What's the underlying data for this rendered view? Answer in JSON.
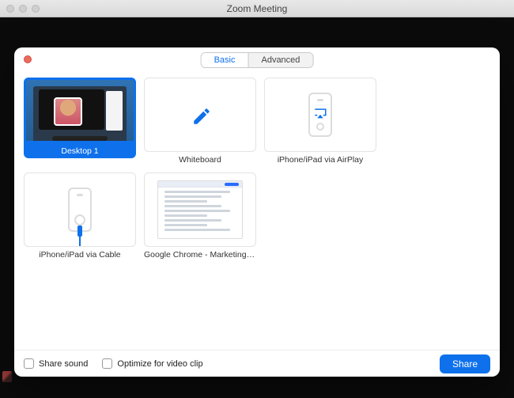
{
  "window": {
    "title": "Zoom Meeting"
  },
  "tabs": {
    "basic": "Basic",
    "advanced": "Advanced",
    "active": "basic"
  },
  "options": [
    {
      "id": "desktop1",
      "label": "Desktop 1",
      "selected": true,
      "kind": "screen"
    },
    {
      "id": "whiteboard",
      "label": "Whiteboard",
      "selected": false,
      "kind": "whiteboard"
    },
    {
      "id": "airplay",
      "label": "iPhone/iPad via AirPlay",
      "selected": false,
      "kind": "airplay"
    },
    {
      "id": "cable",
      "label": "iPhone/iPad via Cable",
      "selected": false,
      "kind": "cable"
    },
    {
      "id": "chrome",
      "label": "Google Chrome - Marketing - Ligh…",
      "selected": false,
      "kind": "app"
    }
  ],
  "footer": {
    "share_sound": "Share sound",
    "optimize_clip": "Optimize for video clip",
    "share_button": "Share"
  },
  "colors": {
    "accent": "#0e71eb"
  }
}
